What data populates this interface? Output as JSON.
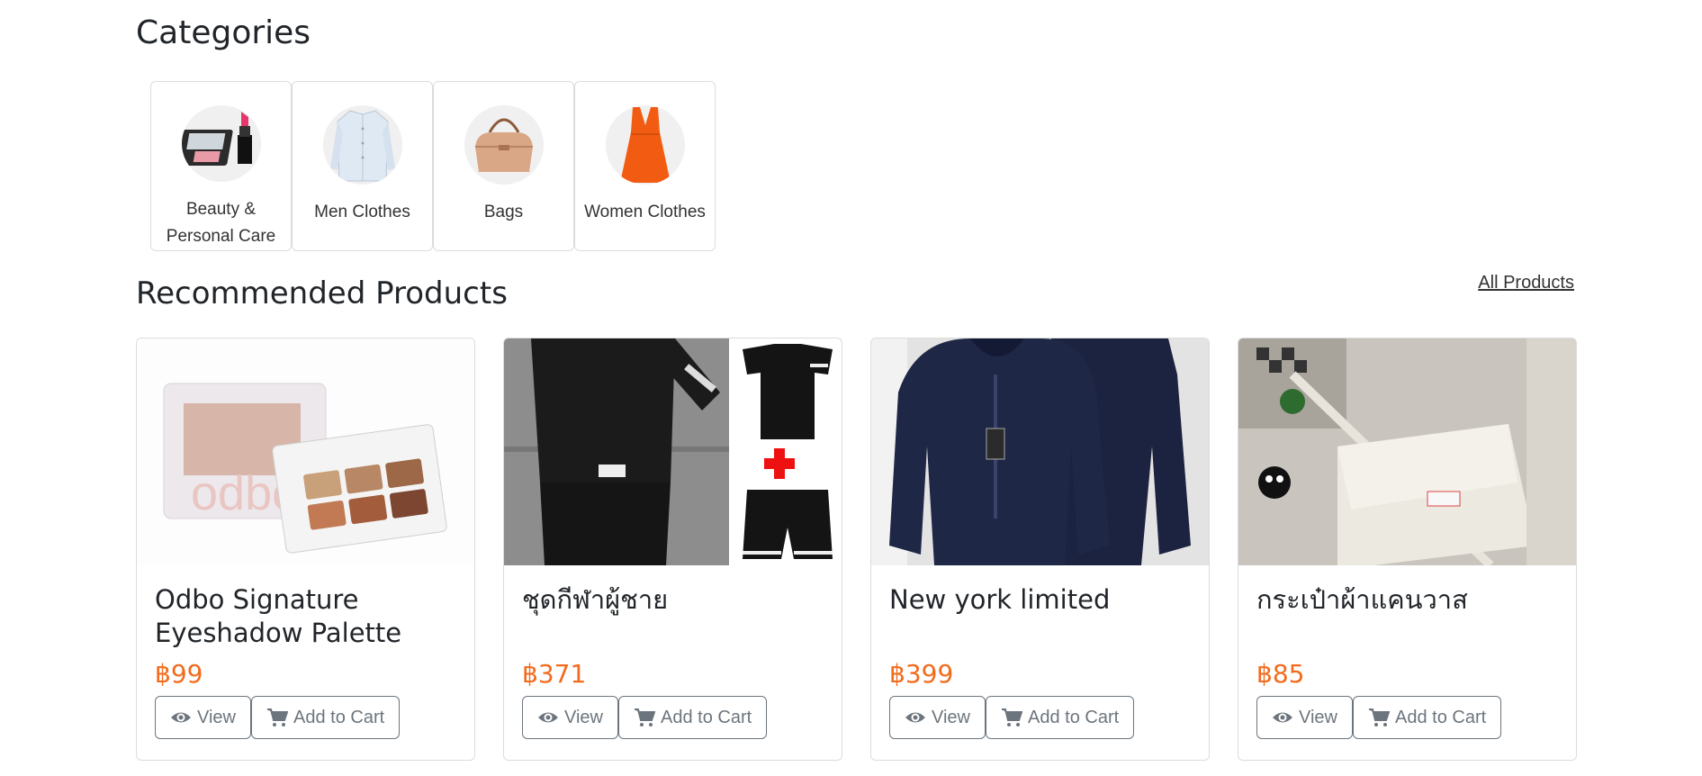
{
  "categories_title": "Categories",
  "categories": [
    {
      "label": "Beauty & Personal Care",
      "icon": "cosmetics-image"
    },
    {
      "label": "Men Clothes",
      "icon": "shirt-image"
    },
    {
      "label": "Bags",
      "icon": "handbag-image"
    },
    {
      "label": "Women Clothes",
      "icon": "dress-image"
    }
  ],
  "recommended_title": "Recommended Products",
  "all_products_link": "All Products",
  "currency_color": "#f26b1d",
  "products": [
    {
      "name": "Odbo Signature Eyeshadow Palette",
      "price": "฿99",
      "view_label": "View",
      "cart_label": "Add to Cart"
    },
    {
      "name": "ชุดกีฬาผู้ชาย",
      "price": "฿371",
      "view_label": "View",
      "cart_label": "Add to Cart"
    },
    {
      "name": "New york limited",
      "price": "฿399",
      "view_label": "View",
      "cart_label": "Add to Cart"
    },
    {
      "name": "กระเป๋าผ้าแคนวาส",
      "price": "฿85",
      "view_label": "View",
      "cart_label": "Add to Cart"
    }
  ]
}
